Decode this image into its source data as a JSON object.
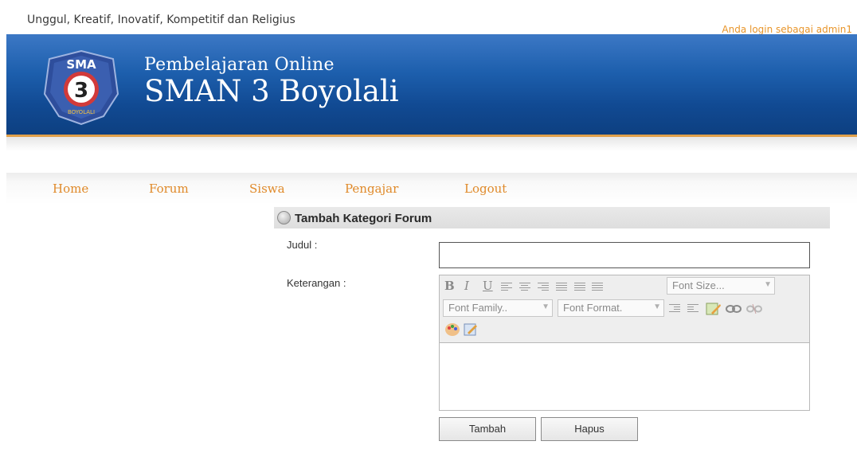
{
  "header": {
    "tagline": "Unggul, Kreatif, Inovatif, Kompetitif dan Religius",
    "login_status": "Anda login sebagai admin1",
    "subtitle": "Pembelajaran Online",
    "title": "SMAN 3 Boyolali",
    "logo_text_top": "SMA",
    "logo_number": "3",
    "logo_text_bottom": "BOYOLALI"
  },
  "nav": {
    "items": [
      {
        "label": "Home"
      },
      {
        "label": "Forum"
      },
      {
        "label": "Siswa"
      },
      {
        "label": "Pengajar"
      },
      {
        "label": "Logout"
      }
    ]
  },
  "form": {
    "section_title": "Tambah Kategori Forum",
    "judul_label": "Judul :",
    "judul_value": "",
    "keterangan_label": "Keterangan :",
    "editor": {
      "font_size_placeholder": "Font Size...",
      "font_family_placeholder": "Font Family..",
      "font_format_placeholder": "Font Format.",
      "bold": "B",
      "italic": "I",
      "underline": "U",
      "content": ""
    },
    "submit_label": "Tambah",
    "reset_label": "Hapus"
  },
  "colors": {
    "banner": "#1d5fad",
    "accent": "#e08a2a",
    "login": "#e8952a"
  }
}
